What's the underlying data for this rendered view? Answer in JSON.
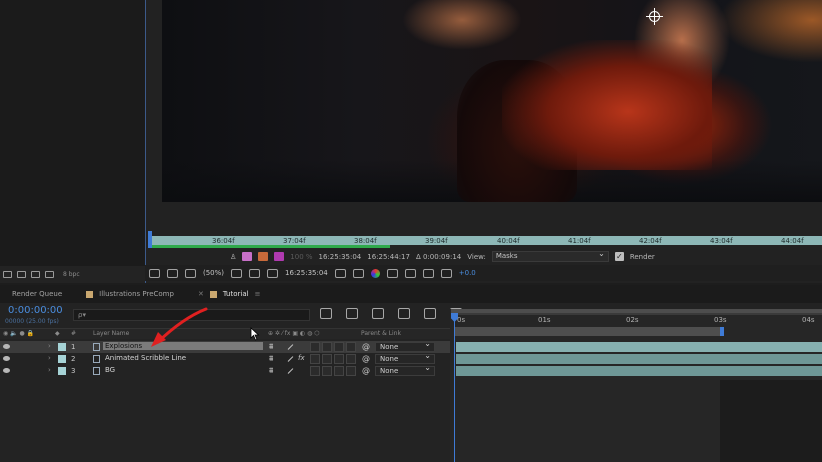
{
  "colors": {
    "accent": "#3f7bd6",
    "timecode": "#4a8dde",
    "layer_label": "#a6d3d6",
    "ruler": "#8db7b6",
    "cache_green": "#2fa94b",
    "annotation_arrow": "#e02020"
  },
  "project_panel": {
    "bpc": "8 bpc"
  },
  "viewer": {
    "ruler_ticks": [
      "36:04f",
      "37:04f",
      "38:04f",
      "39:04f",
      "40:04f",
      "41:04f",
      "42:04f",
      "43:04f",
      "44:04f"
    ],
    "mini_timecode_start": "16:25:35:04",
    "mini_timecode_end": "16:25:44:17",
    "mini_duration": "Δ 0:00:09:14",
    "zoom_dim": "100 %",
    "view_label": "View:",
    "view_value": "Masks",
    "render_label": "Render",
    "zoom": "(50%)",
    "toolbar_timecode": "16:25:35:04",
    "exposure": "+0.0"
  },
  "tabs": [
    {
      "label": "Render Queue"
    },
    {
      "label": "Illustrations PreComp"
    },
    {
      "label": "Tutorial"
    }
  ],
  "timeline": {
    "timecode": "0:00:00:00",
    "fps": "00000 (25.00 fps)",
    "search_placeholder": "ρ▾",
    "columns": {
      "hash": "#",
      "layer_name": "Layer Name",
      "parent_link": "Parent & Link"
    },
    "ticks": [
      "0s",
      "01s",
      "02s",
      "03s",
      "04s"
    ],
    "layers": [
      {
        "num": "1",
        "name": "Explosions",
        "fx": "",
        "parent": "None",
        "selected": true
      },
      {
        "num": "2",
        "name": "Animated Scribble Line",
        "fx": "fx",
        "parent": "None",
        "selected": false
      },
      {
        "num": "3",
        "name": "BG",
        "fx": "",
        "parent": "None",
        "selected": false
      }
    ]
  }
}
